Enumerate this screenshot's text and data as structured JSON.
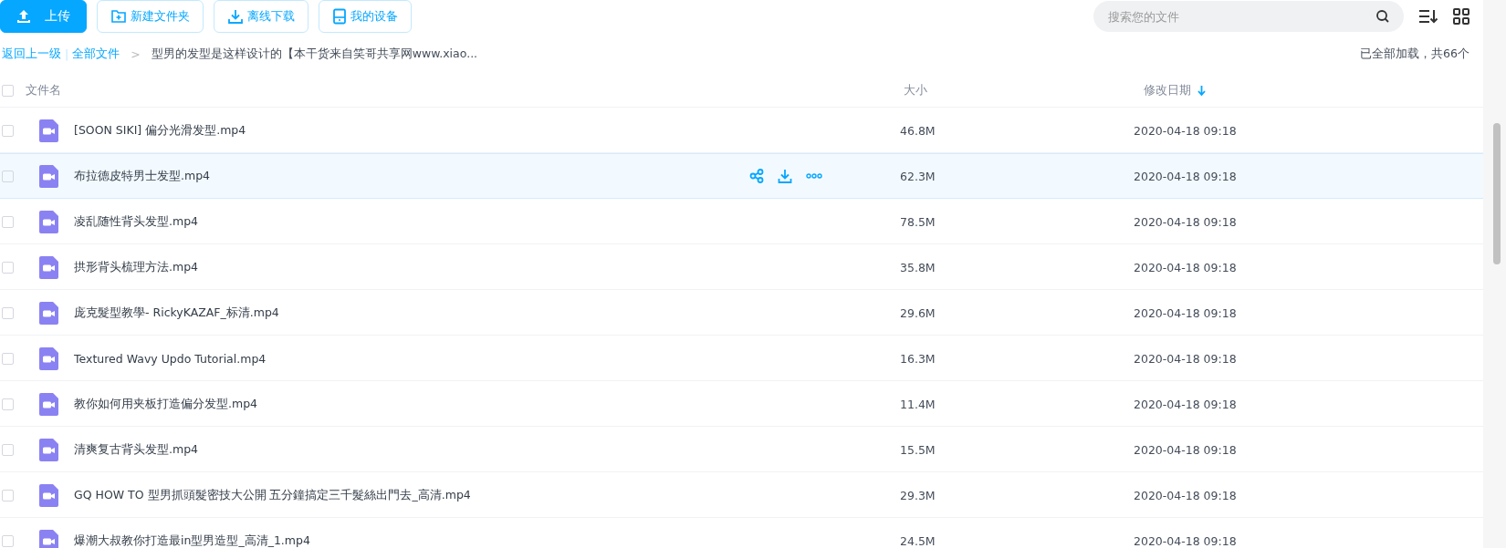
{
  "toolbar": {
    "buttons": [
      {
        "label": "上传",
        "kind": "upload"
      },
      {
        "label": "新建文件夹",
        "kind": "folder"
      },
      {
        "label": "离线下载",
        "kind": "download"
      },
      {
        "label": "我的设备",
        "kind": "device"
      }
    ],
    "search": {
      "placeholder": "搜索您的文件"
    }
  },
  "breadcrumb": {
    "back": "返回上一级",
    "separator": "|",
    "root": "全部文件",
    "arrow": ">",
    "current": "型男的发型是这样设计的【本干货来自笑哥共享网www.xiao..."
  },
  "load_status": "已全部加载，共66个",
  "table": {
    "select_all": {
      "checked": false
    },
    "columns": [
      {
        "label": "文件名",
        "sorted": false
      },
      {
        "label": "大小",
        "sorted": false
      },
      {
        "label": "修改日期",
        "sorted": true
      }
    ],
    "rows": [
      {
        "name": "[SOON SIKI] 偏分光滑发型.mp4",
        "size": "46.8M",
        "date": "2020-04-18 09:18",
        "selected": false,
        "checked": false
      },
      {
        "name": "布拉德皮特男士发型.mp4",
        "size": "62.3M",
        "date": "2020-04-18 09:18",
        "selected": true,
        "checked": false
      },
      {
        "name": "凌乱随性背头发型.mp4",
        "size": "78.5M",
        "date": "2020-04-18 09:18",
        "selected": false,
        "checked": false
      },
      {
        "name": "拱形背头梳理方法.mp4",
        "size": "35.8M",
        "date": "2020-04-18 09:18",
        "selected": false,
        "checked": false
      },
      {
        "name": "庞克髮型教學- RickyKAZAF_标清.mp4",
        "size": "29.6M",
        "date": "2020-04-18 09:18",
        "selected": false,
        "checked": false
      },
      {
        "name": "Textured Wavy Updo Tutorial.mp4",
        "size": "16.3M",
        "date": "2020-04-18 09:18",
        "selected": false,
        "checked": false
      },
      {
        "name": "教你如何用夹板打造偏分发型.mp4",
        "size": "11.4M",
        "date": "2020-04-18 09:18",
        "selected": false,
        "checked": false
      },
      {
        "name": "清爽复古背头发型.mp4",
        "size": "15.5M",
        "date": "2020-04-18 09:18",
        "selected": false,
        "checked": false
      },
      {
        "name": "GQ HOW TO 型男抓頭髮密技大公開 五分鐘搞定三千髮絲出門去_高清.mp4",
        "size": "29.3M",
        "date": "2020-04-18 09:18",
        "selected": false,
        "checked": false
      },
      {
        "name": "爆潮大叔教你打造最in型男造型_高清_1.mp4",
        "size": "24.5M",
        "date": "2020-04-18 09:18",
        "selected": false,
        "checked": false
      }
    ]
  }
}
